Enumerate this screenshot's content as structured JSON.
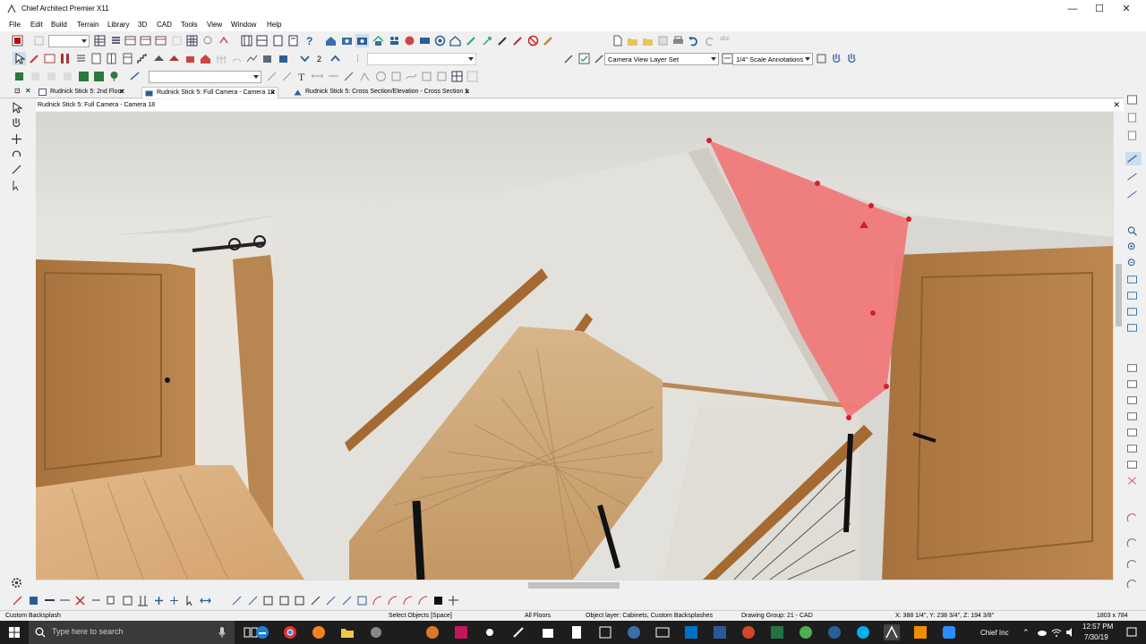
{
  "window": {
    "title": "Chief Architect Premier X11",
    "controls": {
      "minimize": "—",
      "maximize": "☐",
      "close": "✕"
    }
  },
  "menu": [
    "File",
    "Edit",
    "Build",
    "Terrain",
    "Library",
    "3D",
    "CAD",
    "Tools",
    "View",
    "Window",
    "Help"
  ],
  "toolbar": {
    "layer_set": "Camera View Layer Set",
    "annotation_set": "1/4\" Scale Annotations",
    "floor_number": "2",
    "abc_label": "abc"
  },
  "tabs": [
    {
      "label": "Rudnick Stick 5: 2nd Floor",
      "close": "✕"
    },
    {
      "label": "Rudnick Stick 5: Full Camera - Camera 18",
      "close": "✕"
    },
    {
      "label": "Rudnick Stick 5: Cross Section/Elevation - Cross Section 1",
      "close": "✕"
    }
  ],
  "view": {
    "title": "Rudnick Stick 5: Full Camera - Camera 18",
    "close": "✕"
  },
  "status": {
    "selected": "Custom Backsplash",
    "hint": "Select Objects [Space]",
    "floors": "All Floors",
    "object_layer": "Object layer: Cabinets, Custom Backsplashes",
    "drawing_group": "Drawing Group: 21 - CAD",
    "coords": "X: 388 1/4\", Y: 238 3/4\", Z: 194 3/8\"",
    "viewsize": "1803 x 784"
  },
  "taskbar": {
    "search_placeholder": "Type here to search",
    "app_label": "Chief Inc",
    "time": "12:57 PM",
    "date": "7/30/19"
  },
  "colors": {
    "selection_fill": "#f07a7a",
    "selection_handle": "#d02030",
    "wood": "#b9874f",
    "wall": "#e3e1dc"
  }
}
